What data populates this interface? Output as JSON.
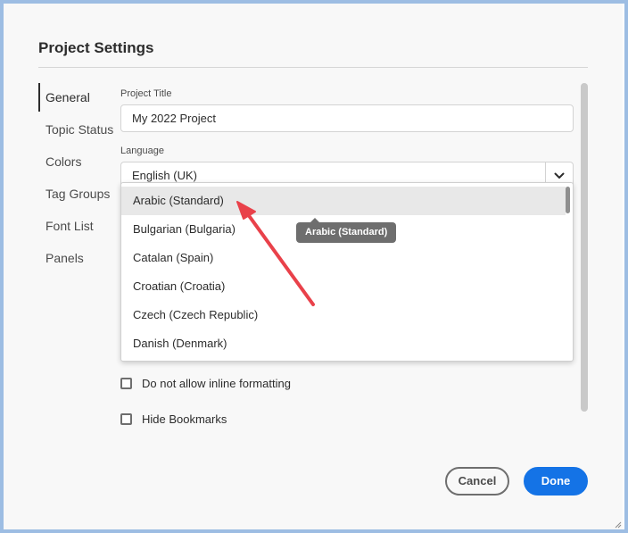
{
  "dialog": {
    "title": "Project Settings"
  },
  "sidebar": {
    "items": [
      {
        "label": "General",
        "active": true
      },
      {
        "label": "Topic Status"
      },
      {
        "label": "Colors"
      },
      {
        "label": "Tag Groups"
      },
      {
        "label": "Font List"
      },
      {
        "label": "Panels"
      }
    ]
  },
  "form": {
    "project_title_label": "Project Title",
    "project_title_value": "My 2022 Project",
    "language_label": "Language",
    "language_value": "English (UK)",
    "language_options": [
      "Arabic (Standard)",
      "Bulgarian (Bulgaria)",
      "Catalan (Spain)",
      "Croatian (Croatia)",
      "Czech (Czech Republic)",
      "Danish (Denmark)"
    ],
    "hovered_option_tooltip": "Arabic (Standard)",
    "checkbox_inline_formatting": "Do not allow inline formatting",
    "checkbox_hide_bookmarks": "Hide Bookmarks"
  },
  "footer": {
    "cancel_label": "Cancel",
    "done_label": "Done"
  },
  "colors": {
    "accent": "#1473e6",
    "annotation_arrow": "#e9414a"
  },
  "icons": {
    "combo_button": "chevron-down-icon",
    "annotation": "red-arrow-icon"
  }
}
